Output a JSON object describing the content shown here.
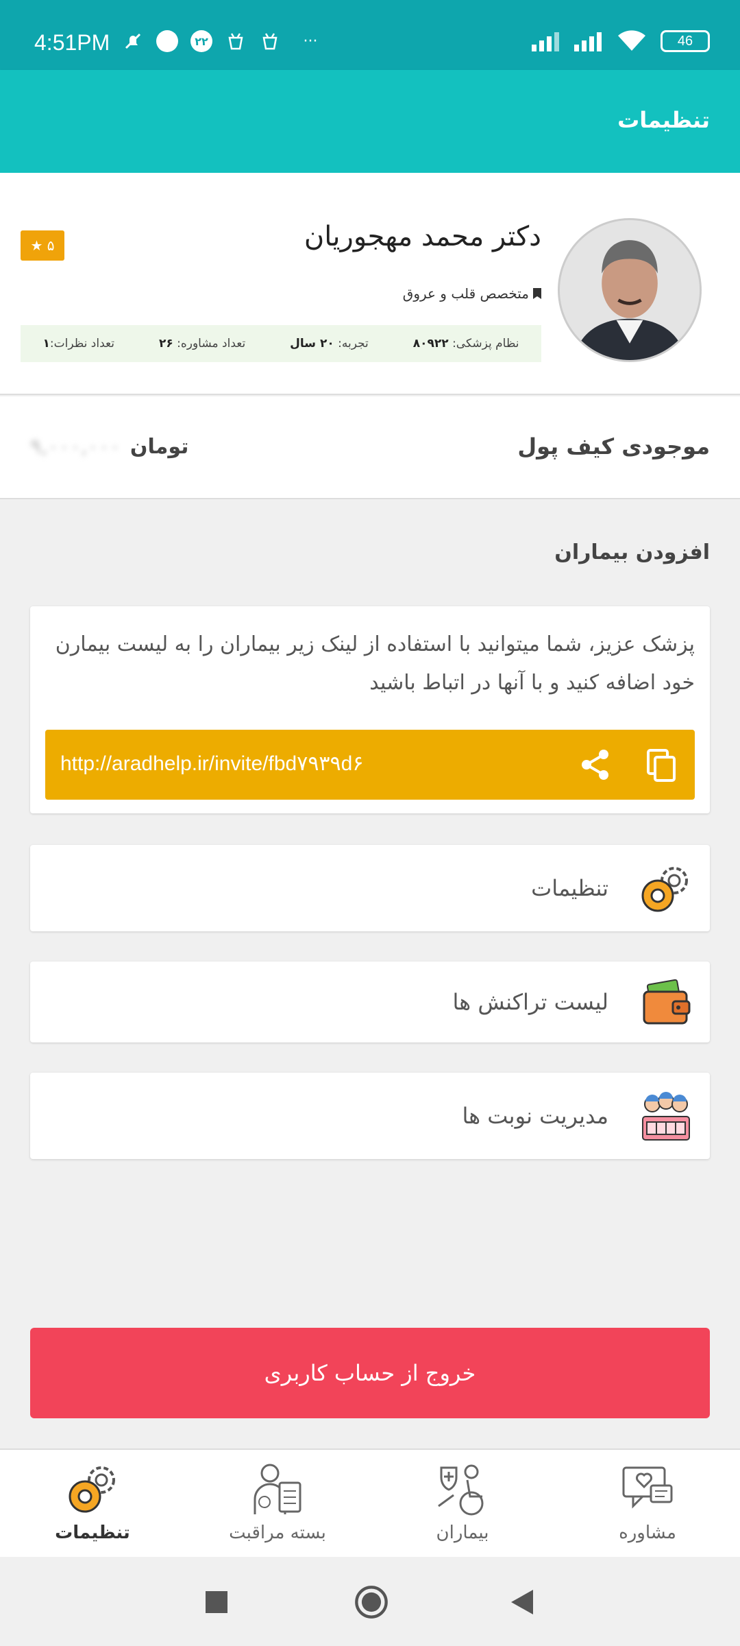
{
  "status_bar": {
    "time": "4:51PM",
    "notif_badge": "۲۲",
    "more": "···",
    "battery": "46"
  },
  "app_bar": {
    "title": "تنظیمات"
  },
  "profile": {
    "name": "دکتر محمد مهجوریان",
    "rating": "۵ ★",
    "specialty": "متخصص قلب و عروق",
    "stats": {
      "license_label": "نظام پزشکی:",
      "license_value": "۸۰۹۲۲",
      "experience_label": "تجربه:",
      "experience_value": "۲۰ سال",
      "consults_label": "تعداد مشاوره:",
      "consults_value": "۲۶",
      "reviews_label": "تعداد نظرات:",
      "reviews_value": "۱"
    }
  },
  "wallet": {
    "label": "موجودی کیف پول",
    "amount": "۹,۰۰۰,۰۰۰",
    "currency": "تومان"
  },
  "add_patients": {
    "title": "افزودن بیماران",
    "message": "پزشک عزیز، شما میتوانید با استفاده از لینک زیر بیماران را به لیست بیمارن خود اضافه کنید و با آنها در اتباط باشید",
    "link": "http://aradhelp.ir/invite/fbd۷۹۳۹d۶"
  },
  "menu": {
    "settings": "تنظیمات",
    "transactions": "لیست تراکنش ها",
    "appointments": "مدیریت نوبت ها"
  },
  "logout": "خروج از حساب کاربری",
  "bottom_nav": {
    "consult": "مشاوره",
    "patients": "بیماران",
    "care_package": "بسته مراقبت",
    "settings": "تنظیمات"
  },
  "colors": {
    "status_bar": "#0ea6ad",
    "app_bar": "#13c1bf",
    "accent_yellow": "#edac00",
    "logout_red": "#f24459",
    "stats_bg": "#eef7ea"
  }
}
